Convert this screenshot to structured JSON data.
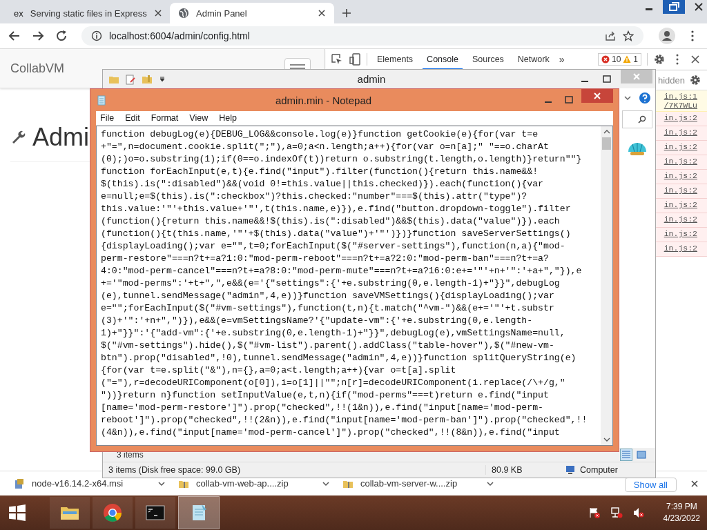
{
  "browser": {
    "tabs": [
      {
        "favicon_text": "ex",
        "title": "Serving static files in Express",
        "selected": false
      },
      {
        "title": "Admin Panel",
        "selected": true
      }
    ],
    "address": "localhost:6004/admin/config.html",
    "page": {
      "brand": "CollabVM",
      "heading": "Admi"
    },
    "devtools": {
      "tabs": [
        {
          "label": "Elements",
          "selected": false
        },
        {
          "label": "Console",
          "selected": true
        },
        {
          "label": "Sources",
          "selected": false
        },
        {
          "label": "Network",
          "selected": false
        }
      ],
      "more": "»",
      "errors": "10",
      "warnings": "1",
      "filter_text": "hidden",
      "console_rows": [
        {
          "kind": "warning",
          "source": "in.js:1",
          "extra": "/7K7WLu"
        },
        {
          "kind": "error",
          "source": "in.js:2"
        },
        {
          "kind": "error",
          "source": "in.js:2"
        },
        {
          "kind": "error",
          "source": "in.js:2"
        },
        {
          "kind": "error",
          "source": "in.js:2"
        },
        {
          "kind": "error",
          "source": "in.js:2"
        },
        {
          "kind": "error",
          "source": "in.js:2"
        },
        {
          "kind": "error",
          "source": "in.js:2"
        },
        {
          "kind": "error",
          "source": "in.js:2"
        },
        {
          "kind": "error",
          "source": "in.js:2"
        },
        {
          "kind": "error",
          "source": "in.js:2"
        }
      ]
    },
    "downloads": {
      "items": [
        "node-v16.14.2-x64.msi",
        "collab-vm-web-ap....zip",
        "collab-vm-server-w....zip"
      ],
      "show_all": "Show all"
    }
  },
  "explorer": {
    "title": "admin",
    "items_count": "3 items",
    "status": "3 items (Disk free space: 99.0 GB)",
    "size": "80.9 KB",
    "location": "Computer"
  },
  "notepad": {
    "title": "admin.min - Notepad",
    "menu": [
      "File",
      "Edit",
      "Format",
      "View",
      "Help"
    ],
    "lines": [
      "function debugLog(e){DEBUG_LOG&&console.log(e)}function getCookie(e){for(var t=e",
      "+\"=\",n=document.cookie.split(\";\"),a=0;a<n.length;a++){for(var o=n[a];\" \"==o.charAt",
      "(0);)o=o.substring(1);if(0==o.indexOf(t))return o.substring(t.length,o.length)}return\"\"}",
      "function forEachInput(e,t){e.find(\"input\").filter(function(){return this.name&&!",
      "$(this).is(\":disabled\")&&(void 0!=this.value||this.checked)}).each(function(){var",
      "e=null;e=$(this).is(\":checkbox\")?this.checked:\"number\"===$(this).attr(\"type\")?",
      "this.value:'\"'+this.value+'\"',t(this.name,e)}),e.find(\"button.dropdown-toggle\").filter",
      "(function(){return this.name&&!$(this).is(\":disabled\")&&$(this).data(\"value\")}).each",
      "(function(){t(this.name,'\"'+$(this).data(\"value\")+'\"')})}function saveServerSettings()",
      "{displayLoading();var e=\"\",t=0;forEachInput($(\"#server-settings\"),function(n,a){\"mod-",
      "perm-restore\"===n?t+=a?1:0:\"mod-perm-reboot\"===n?t+=a?2:0:\"mod-perm-ban\"===n?t+=a?",
      "4:0:\"mod-perm-cancel\"===n?t+=a?8:0:\"mod-perm-mute\"===n?t+=a?16:0:e+='\"'+n+'\":'+a+\",\"}),e",
      "+='\"mod-perms\":'+t+\",\",e&&(e='{\"settings\":{'+e.substring(0,e.length-1)+\"}}\",debugLog",
      "(e),tunnel.sendMessage(\"admin\",4,e))}function saveVMSettings(){displayLoading();var",
      "e=\"\";forEachInput($(\"#vm-settings\"),function(t,n){t.match(\"^vm-\")&&(e+='\"'+t.substr",
      "(3)+'\":'+n+\",\")}),e&&(e=vmSettingsName?'{\"update-vm\":{'+e.substring(0,e.length-",
      "1)+\"}}\":'{\"add-vm\":{'+e.substring(0,e.length-1)+\"}}\",debugLog(e),vmSettingsName=null,",
      "$(\"#vm-settings\").hide(),$(\"#vm-list\").parent().addClass(\"table-hover\"),$(\"#new-vm-",
      "btn\").prop(\"disabled\",!0),tunnel.sendMessage(\"admin\",4,e))}function splitQueryString(e)",
      "{for(var t=e.split(\"&\"),n={},a=0;a<t.length;a++){var o=t[a].split",
      "(\"=\"),r=decodeURIComponent(o[0]),i=o[1]||\"\";n[r]=decodeURIComponent(i.replace(/\\+/g,\"",
      "\"))}return n}function setInputValue(e,t,n){if(\"mod-perms\"===t)return e.find(\"input",
      "[name='mod-perm-restore']\").prop(\"checked\",!!(1&n)),e.find(\"input[name='mod-perm-",
      "reboot']\").prop(\"checked\",!!(2&n)),e.find(\"input[name='mod-perm-ban']\").prop(\"checked\",!!",
      "(4&n)),e.find(\"input[name='mod-perm-cancel']\").prop(\"checked\",!!(8&n)),e.find(\"input"
    ]
  },
  "taskbar": {
    "apps": [
      {
        "kind": "explorer",
        "selected": false
      },
      {
        "kind": "chrome",
        "selected": false
      },
      {
        "kind": "terminal",
        "selected": false
      },
      {
        "kind": "notepad",
        "selected": true
      }
    ],
    "time": "7:39 PM",
    "date": "4/23/2022"
  }
}
